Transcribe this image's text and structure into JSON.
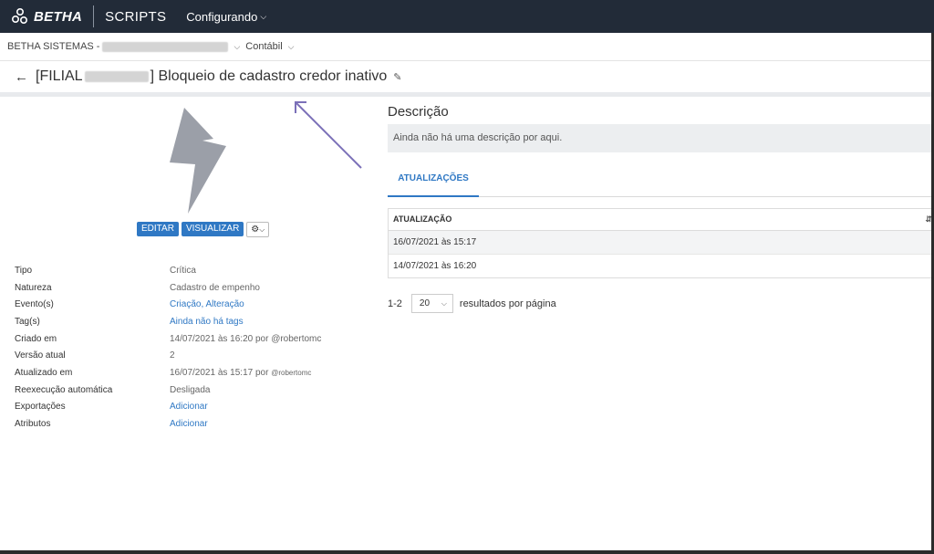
{
  "topbar": {
    "brand": "BETHA",
    "app_name": "SCRIPTS",
    "menu_label": "Configurando"
  },
  "context": {
    "entity_prefix": "BETHA SISTEMAS -",
    "module": "Contábil"
  },
  "header": {
    "title_prefix": "[FILIAL",
    "title_suffix": "] Bloqueio de cadastro credor inativo"
  },
  "actions": {
    "edit": "EDITAR",
    "view": "VISUALIZAR"
  },
  "properties": [
    {
      "key": "Tipo",
      "value": "Crítica"
    },
    {
      "key": "Natureza",
      "value": "Cadastro de empenho"
    },
    {
      "key": "Evento(s)",
      "value": "Criação, Alteração"
    },
    {
      "key": "Tag(s)",
      "value": "Ainda não há tags"
    },
    {
      "key": "Criado em",
      "value": "14/07/2021 às 16:20 por @robertomc"
    },
    {
      "key": "Versão atual",
      "value": "2"
    },
    {
      "key": "Atualizado em",
      "value": "16/07/2021 às 15:17 por",
      "user": "@robertomc"
    },
    {
      "key": "Reexecução automática",
      "value": "Desligada"
    },
    {
      "key": "Exportações",
      "value": "Adicionar"
    },
    {
      "key": "Atributos",
      "value": "Adicionar"
    }
  ],
  "description": {
    "heading": "Descrição",
    "text": "Ainda não há uma descrição por aqui."
  },
  "updates": {
    "tab_label": "ATUALIZAÇÕES",
    "column": "ATUALIZAÇÃO",
    "rows": [
      "16/07/2021 às 15:17",
      "14/07/2021 às 16:20"
    ]
  },
  "pagination": {
    "range": "1-2",
    "page_size": "20",
    "label": "resultados por página"
  },
  "colors": {
    "topbar_bg": "#222b38",
    "primary": "#2f78c4",
    "bolt": "#9b9fa8",
    "annotation_arrow": "#7b70b8"
  }
}
